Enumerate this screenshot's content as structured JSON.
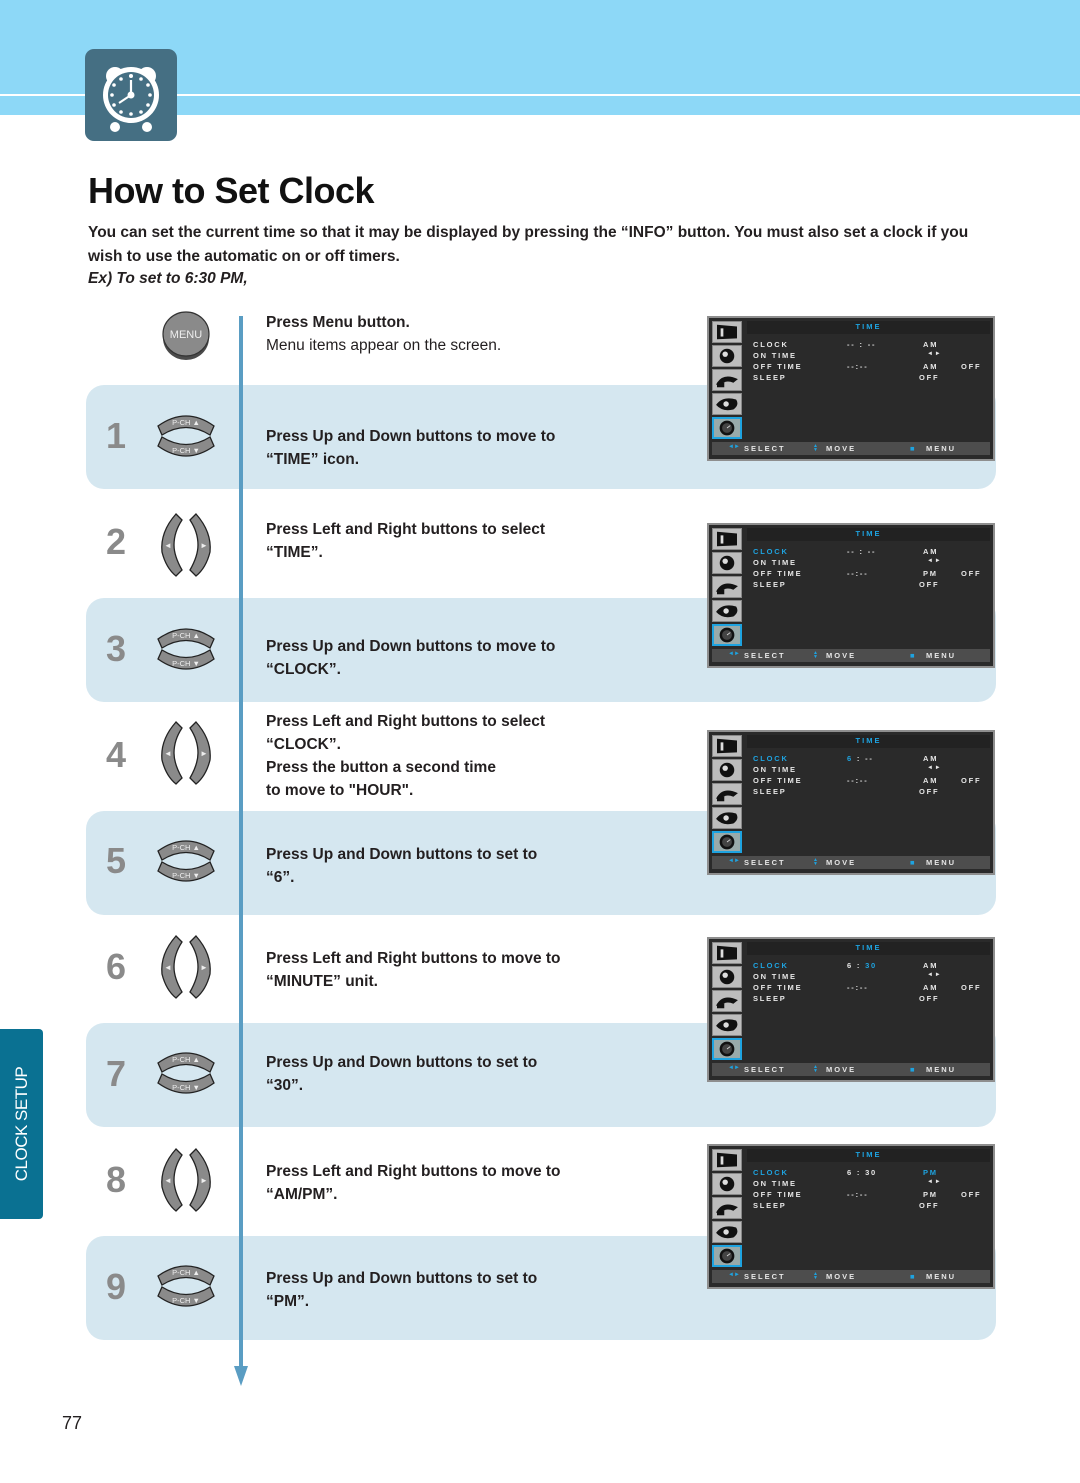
{
  "header": {
    "icon": "alarm-clock-icon",
    "title": "How to Set Clock",
    "intro": "You can set the current time so that it may be displayed by pressing the “INFO” button. You must also set a clock if you wish to use the automatic on or off timers.",
    "example": "Ex) To set to 6:30 PM,"
  },
  "colors": {
    "header_band": "#8dd8f7",
    "badge": "#456f83",
    "band": "#d5e7f0",
    "timeline": "#5a9dc3",
    "side_tab": "#0a7192",
    "osd_highlight": "#1ea3e0"
  },
  "menu_step": {
    "button_label": "MENU",
    "line1": "Press Menu button.",
    "line2": "Menu items appear on the screen."
  },
  "remote": {
    "up_label": "P-CH ▲",
    "down_label": "P-CH ▼",
    "left_glyph": "◄",
    "right_glyph": "►"
  },
  "steps": [
    {
      "num": "1",
      "button": "up-down",
      "lines": [
        "Press Up and Down buttons to move to",
        "“TIME” icon."
      ]
    },
    {
      "num": "2",
      "button": "left-right",
      "lines": [
        "Press Left and Right buttons to select",
        "“TIME”."
      ]
    },
    {
      "num": "3",
      "button": "up-down",
      "lines": [
        "Press Up and Down buttons to move to",
        "“CLOCK”."
      ]
    },
    {
      "num": "4",
      "button": "left-right",
      "lines": [
        "Press Left and Right buttons to select",
        "“CLOCK”.",
        "Press the button a second time",
        "to move to \"HOUR\"."
      ]
    },
    {
      "num": "5",
      "button": "up-down",
      "lines": [
        "Press Up and Down buttons to set to",
        "“6”."
      ]
    },
    {
      "num": "6",
      "button": "left-right",
      "lines": [
        "Press Left and Right buttons to move to",
        "“MINUTE” unit."
      ]
    },
    {
      "num": "7",
      "button": "up-down",
      "lines": [
        "Press Up and Down buttons to set to",
        "“30”."
      ]
    },
    {
      "num": "8",
      "button": "left-right",
      "lines": [
        "Press Left and Right buttons to move to",
        "“AM/PM”."
      ]
    },
    {
      "num": "9",
      "button": "up-down",
      "lines": [
        "Press Up and Down buttons to set to",
        "“PM”."
      ]
    }
  ],
  "osd": {
    "title": "TIME",
    "labels": {
      "clock": "CLOCK",
      "on_time": "ON  TIME",
      "off_time": "OFF  TIME",
      "sleep": "SLEEP"
    },
    "on_time_arrow": "◄►",
    "sleep_value": "OFF",
    "off_time_value": "--:--",
    "off_state": "OFF",
    "footer": {
      "select_icon": "◄►",
      "select": "SELECT",
      "move_icon": "▲▼",
      "move": "MOVE",
      "menu_icon": "■",
      "menu": "MENU"
    },
    "screens": [
      {
        "clock_selected": false,
        "hour": "--",
        "minute": "--",
        "clock_ampm": "AM",
        "off_ampm": "AM",
        "hour_hl": false,
        "minute_hl": false,
        "ampm_hl": false
      },
      {
        "clock_selected": true,
        "hour": "--",
        "minute": "--",
        "clock_ampm": "AM",
        "off_ampm": "PM",
        "hour_hl": false,
        "minute_hl": false,
        "ampm_hl": false
      },
      {
        "clock_selected": true,
        "hour": "6",
        "minute": "--",
        "clock_ampm": "AM",
        "off_ampm": "AM",
        "hour_hl": true,
        "minute_hl": false,
        "ampm_hl": false
      },
      {
        "clock_selected": true,
        "hour": "6",
        "minute": "30",
        "clock_ampm": "AM",
        "off_ampm": "AM",
        "hour_hl": false,
        "minute_hl": true,
        "ampm_hl": false
      },
      {
        "clock_selected": true,
        "hour": "6",
        "minute": "30",
        "clock_ampm": "PM",
        "off_ampm": "PM",
        "hour_hl": false,
        "minute_hl": false,
        "ampm_hl": true
      }
    ],
    "side_icons": [
      "picture-icon",
      "sound-icon",
      "channel-icon",
      "setup-icon",
      "time-icon"
    ]
  },
  "side_tab": {
    "label": "CLOCK SETUP"
  },
  "page_number": "77"
}
